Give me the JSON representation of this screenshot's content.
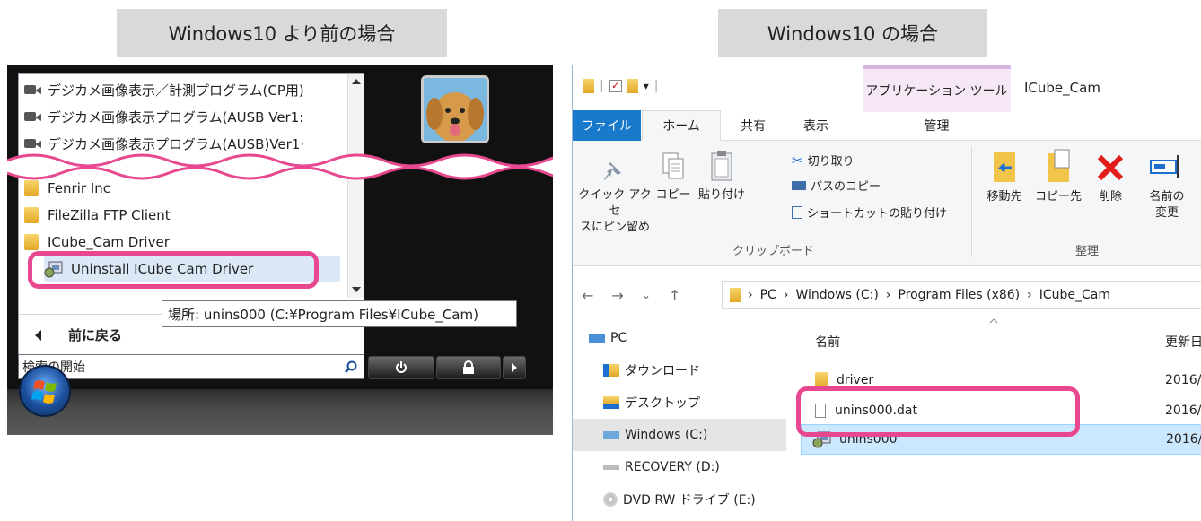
{
  "captions": {
    "left": "Windows10 より前の場合",
    "right": "Windows10 の場合"
  },
  "startmenu": {
    "programs": [
      "デジカメ画像表示／計測プログラム(CP用)",
      "デジカメ画像表示プログラム(AUSB Ver1:",
      "デジカメ画像表示プログラム(AUSB)Ver1·"
    ],
    "folders": [
      "Fenrir Inc",
      "FileZilla FTP Client",
      "ICube_Cam Driver"
    ],
    "highlighted_item": "Uninstall ICube Cam Driver",
    "back_label": "前に戻る",
    "tooltip": "場所: unins000 (C:¥Program Files¥ICube_Cam)",
    "search_placeholder": "検索の開始",
    "colors": {
      "highlight": "#e8488f"
    }
  },
  "explorer": {
    "context_tab": "アプリケーション ツール",
    "window_title": "ICube_Cam",
    "tabs": [
      "ファイル",
      "ホーム",
      "共有",
      "表示",
      "管理"
    ],
    "ribbon": {
      "pin_label_1": "クイック アクセ",
      "pin_label_2": "スにピン留め",
      "copy": "コピー",
      "paste": "貼り付け",
      "cut": "切り取り",
      "copy_path": "パスのコピー",
      "paste_shortcut": "ショートカットの貼り付け",
      "clipboard_group": "クリップボード",
      "move_to": "移動先",
      "copy_to": "コピー先",
      "delete": "削除",
      "rename_1": "名前の",
      "rename_2": "変更",
      "organize_group": "整理"
    },
    "breadcrumb": [
      "PC",
      "Windows (C:)",
      "Program Files (x86)",
      "ICube_Cam"
    ],
    "nav": [
      "PC",
      "ダウンロード",
      "デスクトップ",
      "Windows (C:)",
      "RECOVERY (D:)",
      "DVD RW ドライブ (E:)"
    ],
    "columns": {
      "name": "名前",
      "date": "更新日"
    },
    "files": [
      {
        "name": "driver",
        "date": "2016/"
      },
      {
        "name": "unins000.dat",
        "date": "2016/"
      },
      {
        "name": "unins000",
        "date": "2016/"
      }
    ]
  }
}
